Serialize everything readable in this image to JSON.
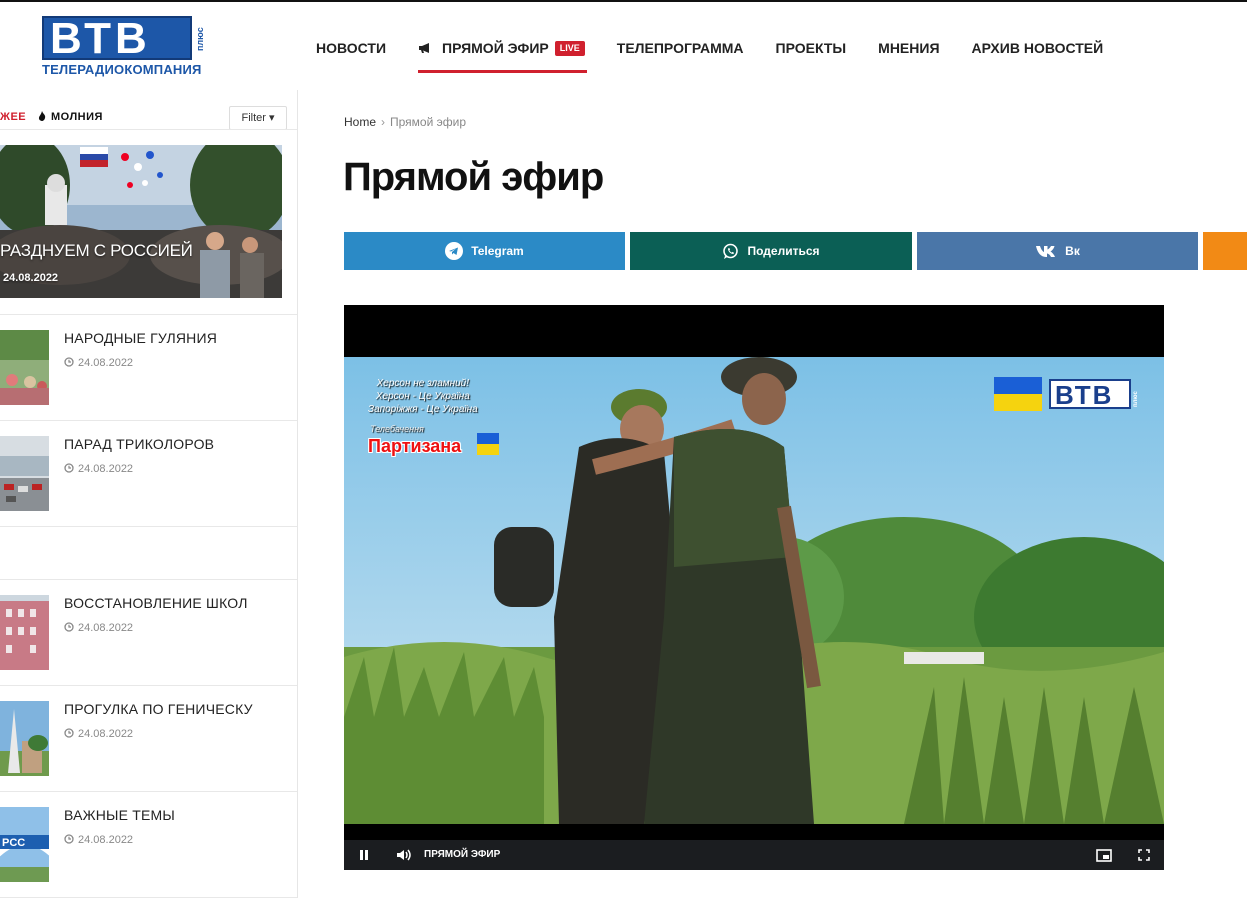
{
  "site": {
    "logo_letters": "ВТВ",
    "logo_plus": "плюс",
    "logo_subtitle": "ТЕЛЕРАДИОКОМПАНИЯ"
  },
  "nav": {
    "items": [
      {
        "label": "НОВОСТИ"
      },
      {
        "label": "ПРЯМОЙ ЭФИР",
        "badge": "LIVE",
        "active": true
      },
      {
        "label": "ТЕЛЕПРОГРАММА"
      },
      {
        "label": "ПРОЕКТЫ"
      },
      {
        "label": "МНЕНИЯ"
      },
      {
        "label": "АРХИВ НОВОСТЕЙ"
      }
    ]
  },
  "sidebar": {
    "tab_red": "ЖЕЕ",
    "tab_dark": "МОЛНИЯ",
    "filter_label": "Filter",
    "featured": {
      "title": "РАЗДНУЕМ С РОССИЕЙ",
      "date": "24.08.2022"
    },
    "items": [
      {
        "title": "НАРОДНЫЕ ГУЛЯНИЯ",
        "date": "24.08.2022"
      },
      {
        "title": "ПАРАД ТРИКОЛОРОВ",
        "date": "24.08.2022"
      },
      {
        "title": "ВОССТАНОВЛЕНИЕ ШКОЛ",
        "date": "24.08.2022"
      },
      {
        "title": "ПРОГУЛКА ПО ГЕНИЧЕСКУ",
        "date": "24.08.2022"
      },
      {
        "title": "ВАЖНЫЕ ТЕМЫ",
        "date": "24.08.2022"
      }
    ]
  },
  "breadcrumb": {
    "home": "Home",
    "current": "Прямой эфир"
  },
  "page": {
    "title": "Прямой эфир"
  },
  "share": {
    "telegram": "Telegram",
    "whatsapp": "Поделиться",
    "vk": "Вк"
  },
  "player": {
    "overlay_line1": "Херсон не зламний!",
    "overlay_line2": "Херсон - Це Україна",
    "overlay_line3": "Запоріжжя - Це Україна",
    "overlay_small": "Телебачення",
    "overlay_big": "Партизана",
    "watermark": "ВТВ",
    "watermark_plus": "плюс",
    "controls_label": "ПРЯМОЙ ЭФИР"
  },
  "colors": {
    "accent_red": "#d0202e",
    "brand_blue": "#1d57a8",
    "telegram": "#2b8ac6",
    "whatsapp": "#0b5f55",
    "vk": "#4a76a8",
    "ok": "#f28a15"
  }
}
